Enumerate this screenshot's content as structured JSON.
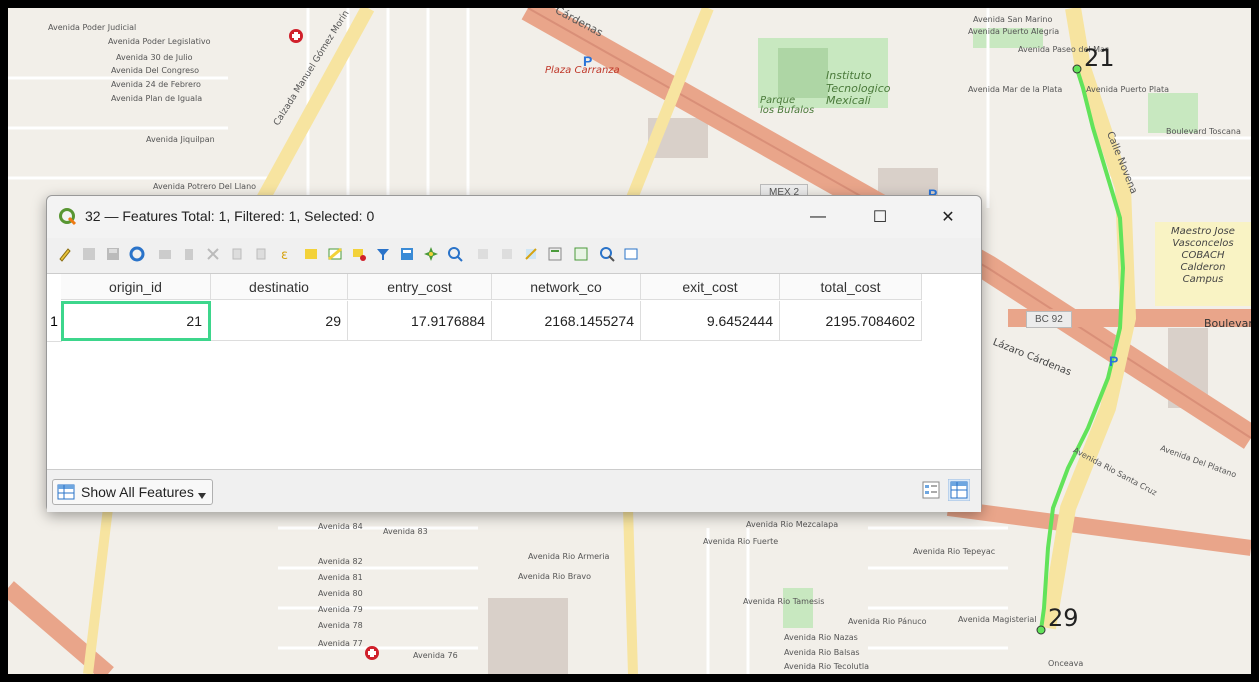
{
  "window": {
    "title": "32 — Features Total: 1, Filtered: 1, Selected: 0",
    "minimize": "—",
    "maximize": "☐",
    "close": "✕"
  },
  "table": {
    "columns": [
      "origin_id",
      "destinatio",
      "entry_cost",
      "network_co",
      "exit_cost",
      "total_cost"
    ],
    "rows": [
      {
        "row_num": "1",
        "cells": [
          "21",
          "29",
          "17.9176884",
          "2168.1455274",
          "9.6452444",
          "2195.7084602"
        ]
      }
    ]
  },
  "bottom": {
    "filter_label": "Show All Features"
  },
  "map": {
    "route_start_label": "21",
    "route_end_label": "29",
    "labels": {
      "av_poder_judicial": "Avenida Poder Judicial",
      "av_poder_legislativo": "Avenida Poder Legislativo",
      "av_30_julio": "Avenida 30 de Julio",
      "av_congreso": "Avenida Del Congreso",
      "av_24_febrero": "Avenida 24 de Febrero",
      "av_plan_iguala": "Avenida Plan de Iguala",
      "av_jiquilpan": "Avenida Jiquilpan",
      "av_potrero": "Avenida Potrero Del Llano",
      "calzada_gomez_morin": "Calzada Manuel Gómez Morín",
      "plaza_carranza": "Plaza Carranza",
      "cardenas_top": "Cárdenas",
      "instituto": "Instituto\nTecnologico\nMexicali",
      "parque_bufalos": "Parque\nlos Bufalos",
      "av_san_marino": "Avenida San Marino",
      "av_puerto_alegria": "Avenida Puerto Alegria",
      "av_paseo_mar": "Avenida Paseo del Mar",
      "av_mar_plata": "Avenida Mar de la Plata",
      "av_puerto_plata": "Avenida Puerto Plata",
      "blvd_toscana": "Boulevard Toscana",
      "calle_novena": "Calle Novena",
      "mex2": "MEX 2",
      "bc92": "BC 92",
      "boulevard": "Boulevard",
      "campus": "Maestro Jose Vasconcelos COBACH Calderon Campus",
      "lazaro_cardenas": "Lázaro Cárdenas",
      "av_rio_mezcalapa": "Avenida Rio Mezcalapa",
      "av_rio_fuerte": "Avenida Rio Fuerte",
      "av_rio_armeria": "Avenida Rio Armeria",
      "av_rio_bravo": "Avenida Rio Bravo",
      "av_rio_tamesis": "Avenida Rio Tamesis",
      "av_rio_nazas": "Avenida Rio Nazas",
      "av_rio_balsas": "Avenida Rio Balsas",
      "av_rio_panuco": "Avenida Rio Pánuco",
      "av_magisterial": "Avenida Magisterial",
      "av_rio_tepeyac": "Avenida Rio Tepeyac",
      "av_rio_tecolutla": "Avenida Rio Tecolutla",
      "av_82": "Avenida 82",
      "av_81": "Avenida 81",
      "av_80": "Avenida 80",
      "av_79": "Avenida 79",
      "av_78": "Avenida 78",
      "av_77": "Avenida 77",
      "av_76": "Avenida 76",
      "av_84": "Avenida 84",
      "av_83": "Avenida 83",
      "av_rio_santa_cruz": "Avenida Rio Santa Cruz",
      "av_del_platano": "Avenida Del Platano",
      "onceava": "Onceava"
    }
  },
  "colors": {
    "route": "#62e35a",
    "selection_border": "#3dd68c",
    "trunk_road": "#e9a58a",
    "primary_road": "#f7e4a0",
    "green_area": "#c8e8c0"
  }
}
